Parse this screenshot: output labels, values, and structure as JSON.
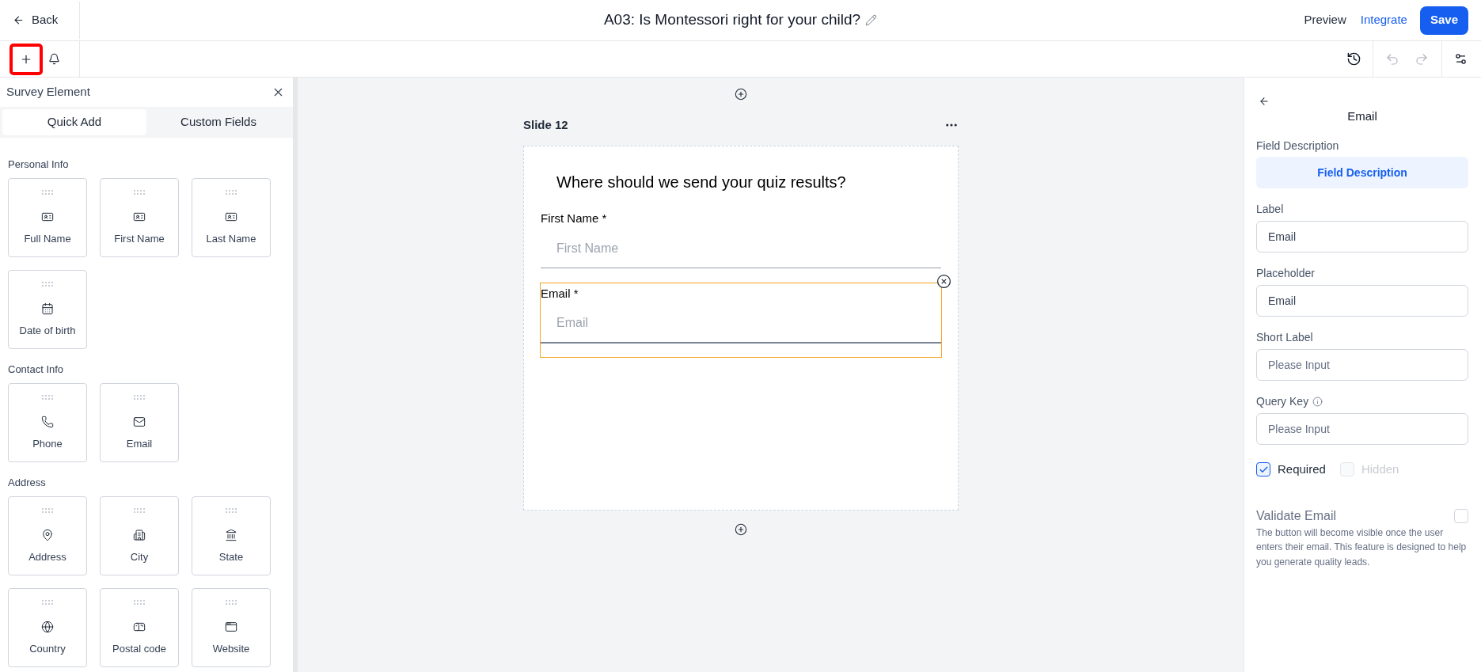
{
  "top_bar": {
    "back": "Back",
    "title": "A03: Is Montessori right for your child?",
    "actions": [
      {
        "label": "Preview",
        "kind": "text"
      },
      {
        "label": "Integrate",
        "kind": "link"
      },
      {
        "label": "Save",
        "kind": "primary"
      }
    ]
  },
  "toolbar": {
    "add": {
      "highlighted": true
    },
    "undo": {
      "disabled": true
    },
    "redo": {
      "disabled": true
    }
  },
  "left_panel": {
    "title": "Survey Element",
    "tabs": [
      {
        "label": "Quick Add",
        "selected": true
      },
      {
        "label": "Custom Fields",
        "selected": false
      }
    ],
    "groups": [
      {
        "title": "Personal Info",
        "items": [
          "Full Name",
          "First Name",
          "Last Name",
          "Date of birth"
        ]
      },
      {
        "title": "Contact Info",
        "items": [
          "Phone",
          "Email"
        ]
      },
      {
        "title": "Address",
        "items": [
          "Address",
          "City",
          "State",
          "Country",
          "Postal code",
          "Website"
        ]
      }
    ]
  },
  "canvas": {
    "slide": {
      "title": "Slide 12",
      "heading": "Where should we send your quiz results?",
      "fields": [
        {
          "label": "First Name",
          "required_mark": "*",
          "placeholder": "First Name",
          "selected": false
        },
        {
          "label": "Email",
          "required_mark": "*",
          "placeholder": "Email",
          "selected": true
        }
      ]
    }
  },
  "properties": {
    "title": "Email",
    "description_label": "Field Description",
    "description_button": "Field Description",
    "inputs": [
      {
        "label": "Label",
        "value": "Email"
      },
      {
        "label": "Placeholder",
        "value": "Email"
      },
      {
        "label": "Short Label",
        "placeholder": "Please Input"
      },
      {
        "label": "Query Key",
        "placeholder": "Please Input",
        "info": true
      }
    ],
    "options": [
      {
        "label": "Required",
        "checked": true,
        "disabled": false
      },
      {
        "label": "Hidden",
        "checked": false,
        "disabled": true
      }
    ],
    "validate": {
      "label": "Validate Email",
      "checked": false,
      "description": "The button will become visible once the user enters their email. This feature is designed to help you generate quality leads."
    }
  }
}
